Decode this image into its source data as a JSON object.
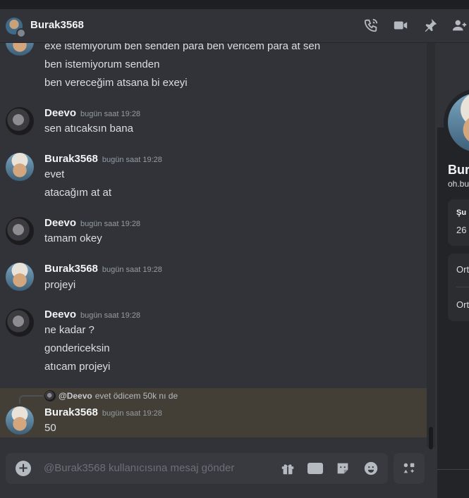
{
  "header": {
    "title": "Burak3568",
    "icons": [
      "phone-call-icon",
      "video-call-icon",
      "pin-icon",
      "add-friend-icon"
    ]
  },
  "messages": [
    {
      "type": "cont",
      "text": "exe istemiyorum ben senden para ben vericem para at sen"
    },
    {
      "type": "cont",
      "text": "ben istemiyorum senden"
    },
    {
      "type": "cont",
      "text": "ben vereceğim atsana bi exeyi"
    },
    {
      "type": "group",
      "author": "Deevo",
      "time": "bugün saat 19:28",
      "lines": [
        "sen atıcaksın bana"
      ]
    },
    {
      "type": "group",
      "author": "Burak3568",
      "time": "bugün saat 19:28",
      "lines": [
        "evet",
        "atacağım at at"
      ]
    },
    {
      "type": "group",
      "author": "Deevo",
      "time": "bugün saat 19:28",
      "lines": [
        "tamam okey"
      ]
    },
    {
      "type": "group",
      "author": "Burak3568",
      "time": "bugün saat 19:28",
      "lines": [
        "projeyi"
      ]
    },
    {
      "type": "group",
      "author": "Deevo",
      "time": "bugün saat 19:28",
      "lines": [
        "ne kadar ?",
        "gondericeksin",
        "atıcam projeyi"
      ]
    },
    {
      "type": "reply-group",
      "reply_to": "@Deevo",
      "reply_text": "evet ödicem 50k nı de",
      "author": "Burak3568",
      "time": "bugün saat 19:28",
      "lines": [
        "50"
      ]
    }
  ],
  "composer": {
    "placeholder": "@Burak3568 kullanıcısına mesaj gönder",
    "gif_label": "GIF",
    "icons": [
      "add-attachment-icon",
      "gift-icon",
      "gif-icon",
      "sticker-icon",
      "emoji-icon",
      "apps-icon"
    ]
  },
  "profile": {
    "name": "Bur",
    "sub": "oh.bu",
    "card1_title": "Şu",
    "card1_text": "26",
    "card2_row1": "Ort",
    "card2_row2": "Ort"
  }
}
